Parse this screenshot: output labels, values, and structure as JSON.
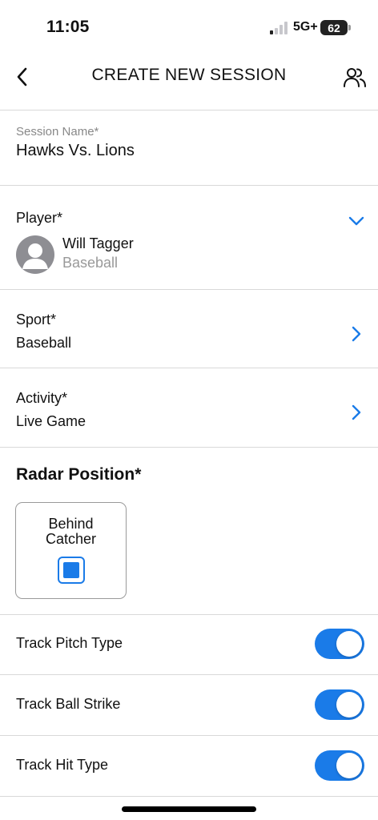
{
  "status_bar": {
    "time": "11:05",
    "network": "5G+",
    "battery": "62"
  },
  "nav": {
    "title": "CREATE NEW SESSION",
    "back_icon": "chevron-left-icon",
    "right_icon": "users-icon"
  },
  "session_name": {
    "label": "Session Name*",
    "value": "Hawks Vs. Lions"
  },
  "player": {
    "label": "Player*",
    "name": "Will Tagger",
    "sport": "Baseball",
    "icon": "chevron-down-icon"
  },
  "sport": {
    "label": "Sport*",
    "value": "Baseball",
    "icon": "chevron-right-icon"
  },
  "activity": {
    "label": "Activity*",
    "value": "Live Game",
    "icon": "chevron-right-icon"
  },
  "radar": {
    "title": "Radar Position*",
    "option_label": "Behind Catcher",
    "selected": true
  },
  "toggles": [
    {
      "label": "Track Pitch Type",
      "on": true
    },
    {
      "label": "Track Ball Strike",
      "on": true
    },
    {
      "label": "Track Hit Type",
      "on": true
    }
  ],
  "colors": {
    "accent": "#1a7be8",
    "divider": "#d9d9d9",
    "muted_text": "#888888"
  }
}
